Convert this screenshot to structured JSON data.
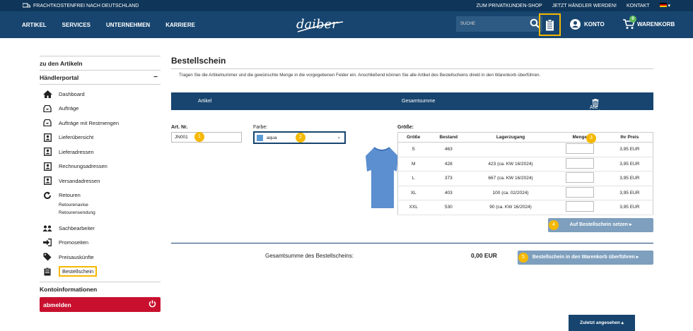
{
  "topbar": {
    "shipping": "FRACHTKOSTENFREI NACH DEUTSCHLAND",
    "links": [
      "ZUM PRIVATKUNDEN-SHOP",
      "JETZT HÄNDLER WERDEN!",
      "KONTAKT"
    ]
  },
  "nav": {
    "items": [
      "ARTIKEL",
      "SERVICES",
      "UNTERNEHMEN",
      "KARRIERE"
    ],
    "logo_text": "daiber",
    "search_placeholder": "SUCHE",
    "konto": "KONTO",
    "cart": "WARENKORB",
    "cart_count": "0"
  },
  "sidebar": {
    "back": "zu den Artikeln",
    "section": "Händlerportal",
    "items": [
      {
        "label": "Dashboard",
        "icon": "home-icon"
      },
      {
        "label": "Aufträge",
        "icon": "inbox-icon"
      },
      {
        "label": "Aufträge mit Restmengen",
        "icon": "inbox-icon"
      },
      {
        "label": "Lieferübersicht",
        "icon": "contact-card-icon"
      },
      {
        "label": "Lieferadressen",
        "icon": "contact-card-icon"
      },
      {
        "label": "Rechnungsadressen",
        "icon": "contact-card-icon"
      },
      {
        "label": "Versandadressen",
        "icon": "contact-card-icon"
      },
      {
        "label": "Retouren",
        "icon": "return-icon"
      }
    ],
    "sub_items": [
      "Retourenavise",
      "Retourensendung"
    ],
    "items2": [
      {
        "label": "Sachbearbeiter",
        "icon": "users-icon"
      },
      {
        "label": "Promoseiten",
        "icon": "sign-in-icon"
      },
      {
        "label": "Preisauskünfte",
        "icon": "tag-icon"
      },
      {
        "label": "Bestellschein",
        "icon": "clipboard-icon"
      }
    ],
    "konto_info": "Kontoinformationen",
    "logout": "abmelden"
  },
  "main": {
    "title": "Bestellschein",
    "intro": "Tragen Sie die Artikelnummer und die gewünschte Menge in die vorgegebenen Felder ein. Anschließend können Sie alle Artikel des Bestellscheins direkt in den Warenkorb überführen.",
    "header": {
      "artikel": "Artikel",
      "gesamt": "Gesamtsumme",
      "clear": "Alle löschen"
    },
    "art_label": "Art. Nr.",
    "art_value": "JN001",
    "farbe_label": "Farbe:",
    "farbe_value": "aqua",
    "groesse_label": "Größe:",
    "columns": [
      "Größe",
      "Bestand",
      "Lagerzugang",
      "Menge",
      "Ihr Preis"
    ],
    "rows": [
      {
        "size": "S",
        "stock": "463",
        "incoming": "",
        "price": "3,95 EUR"
      },
      {
        "size": "M",
        "stock": "428",
        "incoming": "423 (ca. KW 16/2024)",
        "price": "3,95 EUR"
      },
      {
        "size": "L",
        "stock": "373",
        "incoming": "667 (ca. KW 16/2024)",
        "price": "3,95 EUR"
      },
      {
        "size": "XL",
        "stock": "403",
        "incoming": "100 (ca. 02/2024)",
        "price": "3,95 EUR"
      },
      {
        "size": "XXL",
        "stock": "530",
        "incoming": "90 (ca. KW 16/2024)",
        "price": "3,95 EUR"
      }
    ],
    "add_button": "Auf Bestellschein setzen",
    "total_label": "Gesamtsumme des Bestellscheins:",
    "total_value": "0,00 EUR",
    "transfer_button": "Bestellschein in den Warenkorb überführen",
    "steps": [
      "1",
      "2",
      "3",
      "4",
      "5"
    ]
  },
  "recent": "Zuletzt angesehen",
  "colors": {
    "navy": "#17456f",
    "accent": "#f5b800",
    "logout": "#c8102e"
  }
}
